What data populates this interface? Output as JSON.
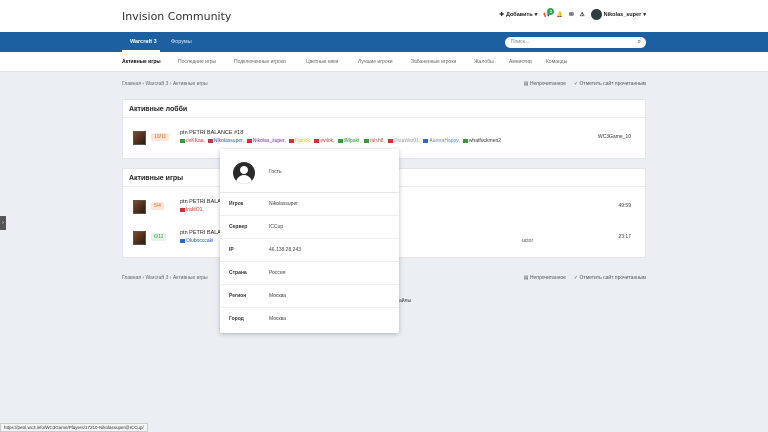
{
  "header": {
    "brand": "Invision Community",
    "add_label": "Добавить",
    "notif_count": "2",
    "username": "Nikolas_super"
  },
  "nav": {
    "items": [
      "Warcraft 3",
      "Форумы"
    ],
    "search_placeholder": "Поиск..."
  },
  "subnav": [
    "Активные игры",
    "Последние игры",
    "Подключенные игроки",
    "Цветные ники",
    "Лучшие игроки",
    "Забаненные игроки",
    "Жалобы",
    "Амнистии",
    "Команды"
  ],
  "breadcrumb": {
    "items": [
      "Главная",
      "Warcraft 3",
      "Активные игры"
    ],
    "unread": "Непрочитанное",
    "mark_read": "Отметить сайт прочитанным"
  },
  "lobbies": {
    "title": "Активные лобби",
    "row": {
      "slots": "10/11",
      "name": "ptn PETRI BALANCE #18",
      "server": "WC3Game_10",
      "players": [
        {
          "name": "ceKKaa,",
          "color": "#d03030"
        },
        {
          "name": "Nikolassuper,",
          "color": "#2255cc"
        },
        {
          "name": "Nikolas_super,",
          "color": "#7a2aa0"
        },
        {
          "name": "Patrick,",
          "color": "#e0c020"
        },
        {
          "name": "evilok,",
          "color": "#c04040"
        },
        {
          "name": "ilMpakt,",
          "color": "#2a9a3a"
        },
        {
          "name": "ralsh8,",
          "color": "#c05050"
        },
        {
          "name": "DotaWar01,",
          "color": "#999999"
        },
        {
          "name": "AuroraHappy,",
          "color": "#4a90e0"
        },
        {
          "name": "whatfuckmen2",
          "color": "#333333"
        }
      ]
    }
  },
  "games": {
    "title": "Активные игры",
    "rows": [
      {
        "slots": "5/4",
        "name": "ptn PETRI BALA",
        "player": "traktO1,",
        "time": "49:59",
        "badge": "orange"
      },
      {
        "slots": "6/11",
        "name": "ptn PETRI BALA",
        "player": "Olubocccaki",
        "extra": "uctor",
        "time": "23:17",
        "badge": "green"
      }
    ]
  },
  "popup": {
    "role": "Гость",
    "rows": [
      {
        "label": "Игрок",
        "value": "Nikolassuper"
      },
      {
        "label": "Сервер",
        "value": "ICCup"
      },
      {
        "label": "IP",
        "value": "46.138.28.243"
      },
      {
        "label": "Страна",
        "value": "Россия"
      },
      {
        "label": "Регион",
        "value": "Москва"
      },
      {
        "label": "Город",
        "value": "Москва"
      }
    ]
  },
  "cookie_text": "okie-файлы",
  "status_url": "https://petri.wc3.info/WC3Game/Players/17210-Nikolassuper@ICCup/"
}
